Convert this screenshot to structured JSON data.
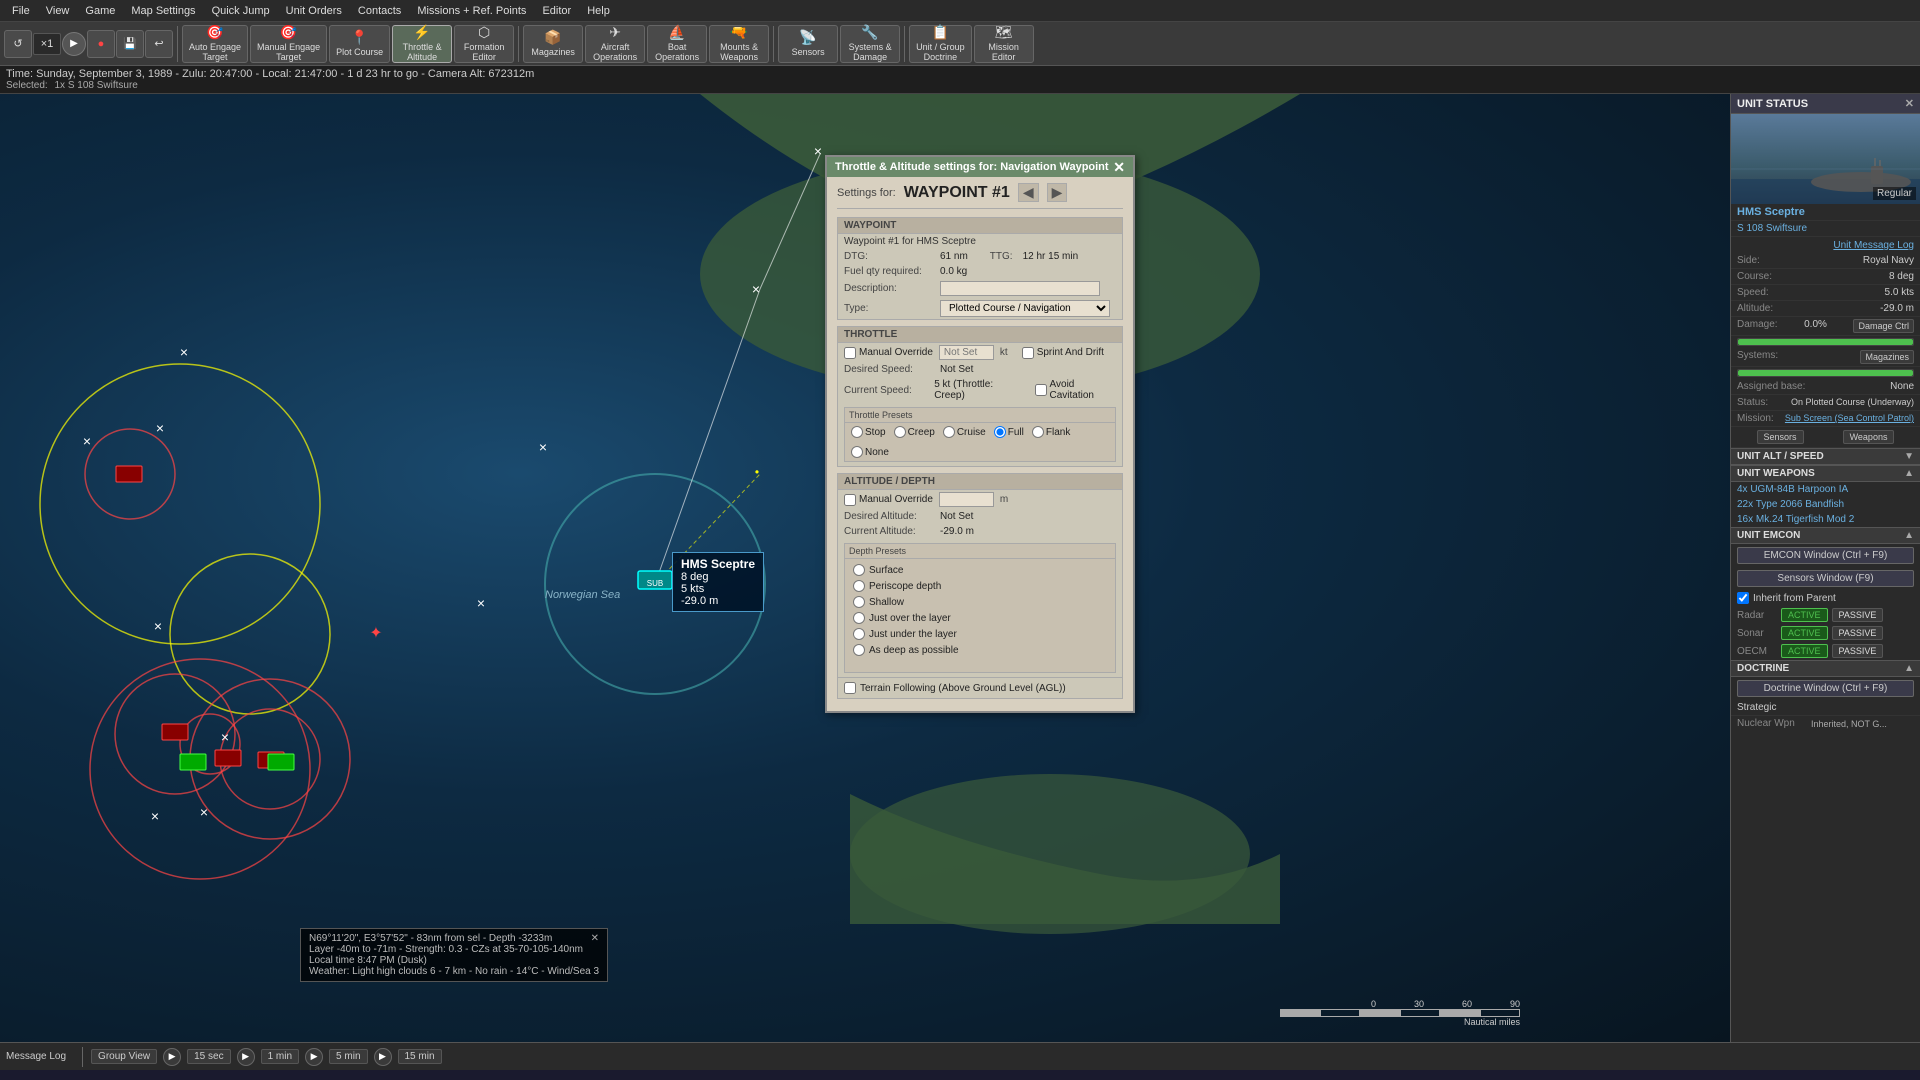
{
  "menubar": {
    "items": [
      "File",
      "View",
      "Game",
      "Map Settings",
      "Quick Jump",
      "Unit Orders",
      "Contacts",
      "Missions + Ref. Points",
      "Editor",
      "Help"
    ]
  },
  "toolbar": {
    "controls": [
      {
        "id": "rewind",
        "icon": "↺",
        "label": ""
      },
      {
        "id": "speed",
        "label": "×1"
      },
      {
        "id": "pause",
        "icon": "▐▐",
        "label": ""
      },
      {
        "id": "record",
        "icon": "●",
        "label": ""
      },
      {
        "id": "save",
        "icon": "💾",
        "label": ""
      },
      {
        "id": "undo",
        "icon": "↩",
        "label": ""
      }
    ],
    "buttons": [
      {
        "id": "auto-engage",
        "label": "Auto Engage\nTarget",
        "icon": "🎯"
      },
      {
        "id": "manual-engage",
        "label": "Manual Engage\nTarget",
        "icon": "🎯"
      },
      {
        "id": "plot-course",
        "label": "Plot Course",
        "icon": "📍"
      },
      {
        "id": "throttle-altitude",
        "label": "Throttle &\nAltitude",
        "icon": "⚡"
      },
      {
        "id": "formation-editor",
        "label": "Formation\nEditor",
        "icon": "⬡"
      },
      {
        "id": "magazines",
        "label": "Magazines",
        "icon": "📦"
      },
      {
        "id": "aircraft-ops",
        "label": "Aircraft\nOperations",
        "icon": "✈"
      },
      {
        "id": "boat-ops",
        "label": "Boat\nOperations",
        "icon": "⛵"
      },
      {
        "id": "mounts-weapons",
        "label": "Mounts &\nWeapons",
        "icon": "🔫"
      },
      {
        "id": "sensors",
        "label": "Sensors",
        "icon": "📡"
      },
      {
        "id": "systems-damage",
        "label": "Systems &\nDamage",
        "icon": "🔧"
      },
      {
        "id": "unit-group-doctrine",
        "label": "Unit / Group\nDoctrine",
        "icon": "📋"
      },
      {
        "id": "mission-editor",
        "label": "Mission\nEditor",
        "icon": "🗺"
      }
    ]
  },
  "statusbar": {
    "time_line": "Time: Sunday, September 3, 1989 - Zulu: 20:47:00 - Local: 21:47:00 - 1 d 23 hr to go  -  Camera Alt: 672312m",
    "selected_label": "Selected:",
    "selected_unit": "1x S 108 Swiftsure"
  },
  "map": {
    "label": "Norwegian Sea",
    "unit_tooltip": {
      "name": "HMS Sceptre",
      "course": "8 deg",
      "speed": "5 kts",
      "depth": "-29.0 m"
    },
    "coord_info": {
      "line1": "N69°11'20\", E3°57'52\" - 83nm from sel - Depth -3233m",
      "line2": "Layer -40m to -71m - Strength: 0.3 - CZs at 35-70-105-140nm",
      "line3": "Local time 8:47 PM (Dusk)",
      "line4": "Weather: Light high clouds 6 - 7 km - No rain - 14°C - Wind/Sea 3"
    }
  },
  "throttle_dialog": {
    "title": "Throttle & Altitude settings for: Navigation Waypoint",
    "settings_for_label": "Settings for:",
    "waypoint_name": "WAYPOINT #1",
    "waypoint_section": {
      "title": "WAYPOINT",
      "description_line": "Waypoint #1 for HMS Sceptre",
      "dtg_label": "DTG:",
      "dtg_value": "61 nm",
      "ttg_label": "TTG:",
      "ttg_value": "12 hr 15 min",
      "fuel_label": "Fuel qty required:",
      "fuel_value": "0.0 kg",
      "desc_label": "Description:",
      "desc_value": "",
      "type_label": "Type:",
      "type_value": "Plotted Course / Navigation"
    },
    "throttle_section": {
      "title": "THROTTLE",
      "manual_override_label": "Manual Override",
      "manual_override_checked": false,
      "speed_input_placeholder": "Not Set",
      "speed_unit": "kt",
      "sprint_drift_label": "Sprint And Drift",
      "sprint_drift_checked": false,
      "desired_speed_label": "Desired Speed:",
      "desired_speed_value": "Not Set",
      "current_speed_label": "Current Speed:",
      "current_speed_value": "5 kt (Throttle: Creep)",
      "avoid_cavitation_label": "Avoid Cavitation",
      "avoid_cavitation_checked": false,
      "presets_title": "Throttle Presets",
      "presets": [
        "Stop",
        "Creep",
        "Cruise",
        "Full",
        "Flank",
        "None"
      ],
      "selected_preset": "Full"
    },
    "altitude_section": {
      "title": "ALTITUDE / DEPTH",
      "manual_override_label": "Manual Override",
      "manual_override_checked": false,
      "altitude_input_placeholder": "",
      "altitude_unit": "m",
      "desired_alt_label": "Desired Altitude:",
      "desired_alt_value": "Not Set",
      "current_alt_label": "Current Altitude:",
      "current_alt_value": "-29.0 m",
      "depth_presets_title": "Depth Presets",
      "depth_presets": [
        "Surface",
        "Periscope depth",
        "Shallow",
        "Just over the layer",
        "Just under the layer",
        "As deep as possible"
      ],
      "terrain_label": "Terrain Following (Above Ground Level (AGL))",
      "terrain_checked": false
    }
  },
  "right_panel": {
    "unit_status_title": "UNIT STATUS",
    "unit_name": "HMS Sceptre",
    "unit_class": "Regular",
    "unit_type": "S 108 Swiftsure",
    "side_label": "Side:",
    "side_value": "Royal Navy",
    "course_label": "Course:",
    "course_value": "8 deg",
    "speed_label": "Speed:",
    "speed_value": "5.0 kts",
    "altitude_label": "Altitude:",
    "altitude_value": "-29.0 m",
    "damage_label": "Damage:",
    "damage_value": "0.0%",
    "damage_btn": "Damage Ctrl",
    "systems_label": "Systems:",
    "magazines_btn": "Magazines",
    "assigned_base_label": "Assigned base:",
    "assigned_base_value": "None",
    "status_label": "Status:",
    "status_value": "On Plotted Course (Underway)",
    "mission_label": "Mission:",
    "mission_value": "Sub Screen (Sea Control Patrol)",
    "sensors_btn": "Sensors",
    "weapons_btn": "Weapons",
    "alt_speed_section": "UNIT ALT / SPEED",
    "weapons_section": "UNIT WEAPONS",
    "weapons": [
      "4x UGM-84B Harpoon IA",
      "22x Type 2066 Bandfish",
      "16x Mk.24 Tigerfish Mod 2"
    ],
    "emcon_section": "UNIT EMCON",
    "emcon_window_btn": "EMCON Window (Ctrl + F9)",
    "sensors_window_btn": "Sensors Window (F9)",
    "inherit_parent_label": "Inherit from Parent",
    "inherit_checked": true,
    "emcon_rows": [
      {
        "label": "Radar",
        "active": "ACTIVE",
        "passive": "PASSIVE"
      },
      {
        "label": "Sonar",
        "active": "ACTIVE",
        "passive": "PASSIVE"
      },
      {
        "label": "OECM",
        "active": "ACTIVE",
        "passive": "PASSIVE"
      }
    ],
    "doctrine_section": "DOCTRINE",
    "doctrine_btn": "Doctrine Window (Ctrl + F9)",
    "strategic_label": "Strategic",
    "nuclear_wpn_label": "Nuclear Wpn",
    "nuclear_value": "Inherited, NOT G..."
  },
  "scale_bar": {
    "labels": [
      "0",
      "30",
      "60",
      "90"
    ],
    "unit": "Nautical miles"
  },
  "bottombar": {
    "message_log": "Message Log",
    "view_btn": "Group View",
    "time_btns": [
      "15 sec",
      "1 min",
      "5 min",
      "15 min"
    ]
  }
}
